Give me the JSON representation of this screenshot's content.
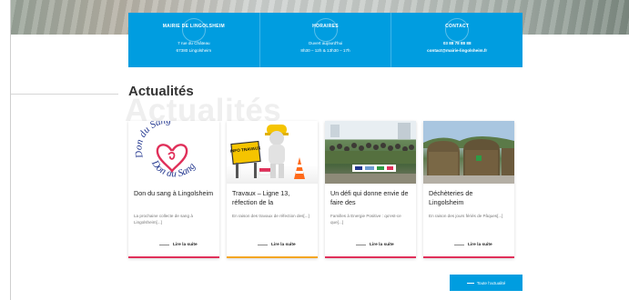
{
  "info_bar": {
    "mairie": {
      "title": "MAIRIE DE LINGOLSHEIM",
      "line1": "7 rue du Château",
      "line2": "67380 Lingolsheim"
    },
    "horaires": {
      "title": "HORAIRES",
      "line1": "Ouvert aujourd'hui",
      "line2": "8h30 – 12h & 13h30 – 17h"
    },
    "contact": {
      "title": "CONTACT",
      "line1": "03 88 78 88 88",
      "line2": "contact@mairie-lingolsheim.fr"
    }
  },
  "section": {
    "title": "Actualités",
    "ghost": "Actualités"
  },
  "cards": [
    {
      "title": "Don du sang à Lingolsheim",
      "excerpt": "La prochaine collecte de sang à Lingolsheim[...]",
      "link": "Lire la suite",
      "image": "Don du Sang",
      "accent": "#e0305a"
    },
    {
      "title": "Travaux – Ligne 13, réfection de la",
      "excerpt": "En raison des travaux de réfection des[...]",
      "link": "Lire la suite",
      "image": "INFO TRAVAUX",
      "accent": "#f4a623"
    },
    {
      "title": "Un défi qui donne envie de faire des",
      "excerpt": "Familles à Energie Positive : qu'est-ce que[...]",
      "link": "Lire la suite",
      "image": "",
      "accent": "#e0305a"
    },
    {
      "title": "Déchèteries de Lingolsheim",
      "excerpt": "En raison des jours fériés de Pâques[...]",
      "link": "Lire la suite",
      "image": "",
      "accent": "#e0305a"
    }
  ],
  "all_news": {
    "label": "Toute l'actualité"
  },
  "colors": {
    "primary": "#009de0",
    "accent_red": "#e0305a",
    "accent_orange": "#f4a623"
  }
}
